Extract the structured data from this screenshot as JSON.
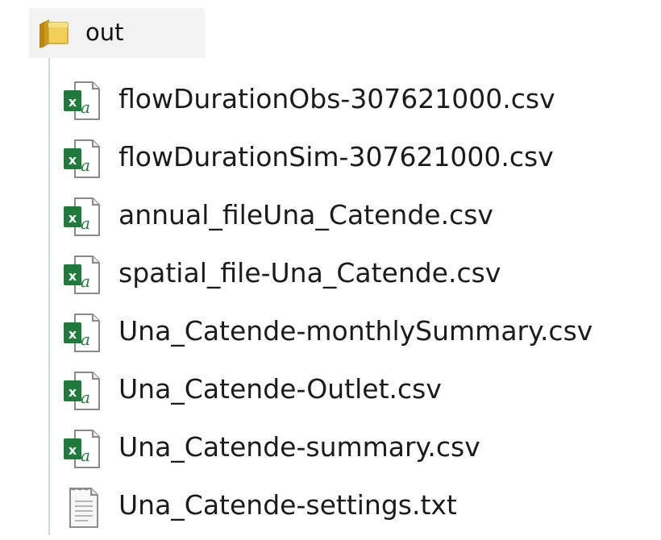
{
  "folder": {
    "name": "out",
    "icon": "folder-icon"
  },
  "files": [
    {
      "name": "flowDurationObs-307621000.csv",
      "icon": "excel-csv-icon"
    },
    {
      "name": "flowDurationSim-307621000.csv",
      "icon": "excel-csv-icon"
    },
    {
      "name": "annual_fileUna_Catende.csv",
      "icon": "excel-csv-icon"
    },
    {
      "name": "spatial_file-Una_Catende.csv",
      "icon": "excel-csv-icon"
    },
    {
      "name": "Una_Catende-monthlySummary.csv",
      "icon": "excel-csv-icon"
    },
    {
      "name": "Una_Catende-Outlet.csv",
      "icon": "excel-csv-icon"
    },
    {
      "name": "Una_Catende-summary.csv",
      "icon": "excel-csv-icon"
    },
    {
      "name": "Una_Catende-settings.txt",
      "icon": "text-file-icon"
    }
  ],
  "colors": {
    "excel_green": "#1f7a3c",
    "folder_yellow": "#e8c44a",
    "selection_bg": "#f3f3f3",
    "tree_line": "#c9d8ea"
  }
}
